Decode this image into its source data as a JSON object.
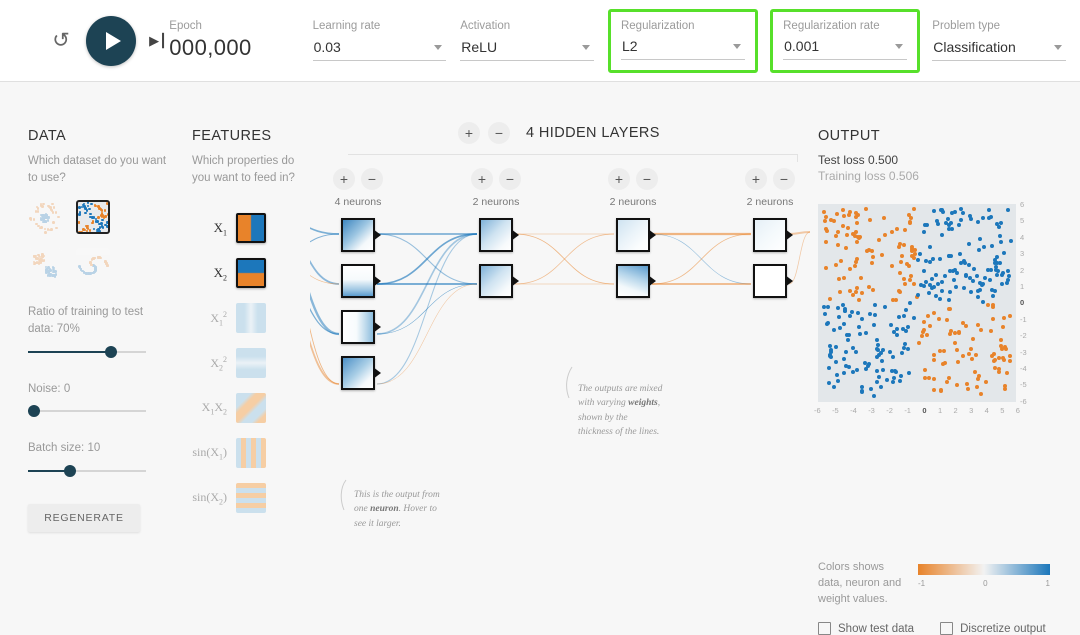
{
  "toolbar": {
    "reset_icon": "reset-icon",
    "play_icon": "play-icon",
    "step_icon": "step-forward-icon",
    "epoch": {
      "label": "Epoch",
      "value": "000,000"
    },
    "controls": [
      {
        "label": "Learning rate",
        "value": "0.03",
        "highlighted": false
      },
      {
        "label": "Activation",
        "value": "ReLU",
        "highlighted": false
      },
      {
        "label": "Regularization",
        "value": "L2",
        "highlighted": true
      },
      {
        "label": "Regularization rate",
        "value": "0.001",
        "highlighted": true
      },
      {
        "label": "Problem type",
        "value": "Classification",
        "highlighted": false
      }
    ]
  },
  "data_panel": {
    "title": "DATA",
    "subtitle": "Which dataset do you want to use?",
    "datasets": [
      {
        "name": "circle",
        "selected": false
      },
      {
        "name": "exclusive-or",
        "selected": true
      },
      {
        "name": "gaussian",
        "selected": false
      },
      {
        "name": "spiral",
        "selected": false
      }
    ],
    "ratio": {
      "label": "Ratio of training to test data:",
      "value": "70%",
      "percent": 70
    },
    "noise": {
      "label": "Noise:",
      "value": "0",
      "percent": 0
    },
    "batch": {
      "label": "Batch size:",
      "value": "10",
      "percent": 36
    },
    "regenerate_label": "REGENERATE"
  },
  "features_panel": {
    "title": "FEATURES",
    "subtitle": "Which properties do you want to feed in?",
    "features": [
      {
        "name": "X1",
        "active": true
      },
      {
        "name": "X2",
        "active": true
      },
      {
        "name": "X1sq",
        "active": false
      },
      {
        "name": "X2sq",
        "active": false
      },
      {
        "name": "X1X2",
        "active": false
      },
      {
        "name": "sinX1",
        "active": false
      },
      {
        "name": "sinX2",
        "active": false
      }
    ]
  },
  "network": {
    "add_label": "+",
    "remove_label": "−",
    "hidden_layers_count": "4",
    "hidden_layers_label": "HIDDEN LAYERS",
    "layers": [
      {
        "neurons_label": "4 neurons",
        "count": 4
      },
      {
        "neurons_label": "2 neurons",
        "count": 2
      },
      {
        "neurons_label": "2 neurons",
        "count": 2
      },
      {
        "neurons_label": "2 neurons",
        "count": 2
      }
    ],
    "annotation_neuron": "This is the output from one neuron. Hover to see it larger.",
    "annotation_weights": "The outputs are mixed with varying weights, shown by the thickness of the lines."
  },
  "output_panel": {
    "title": "OUTPUT",
    "test_loss": "Test loss 0.500",
    "training_loss": "Training loss 0.506",
    "axis_x": [
      "-6",
      "-5",
      "-4",
      "-3",
      "-2",
      "-1",
      "0",
      "1",
      "2",
      "3",
      "4",
      "5",
      "6"
    ],
    "axis_y": [
      "6",
      "5",
      "4",
      "3",
      "2",
      "1",
      "0",
      "-1",
      "-2",
      "-3",
      "-4",
      "-5",
      "-6"
    ],
    "colorbar": {
      "text": "Colors shows data, neuron and weight values.",
      "min": "-1",
      "mid": "0",
      "max": "1",
      "negative_color": "#e8832a",
      "neutral_color": "#f2f2f2",
      "positive_color": "#1c77bb"
    },
    "checkboxes": [
      {
        "label": "Show test data",
        "checked": false
      },
      {
        "label": "Discretize output",
        "checked": false
      }
    ]
  },
  "chart_data": {
    "type": "scatter",
    "title": "OUTPUT",
    "xlabel": "",
    "ylabel": "",
    "xlim": [
      -6,
      6
    ],
    "ylim": [
      -6,
      6
    ],
    "grid": false,
    "legend": "none",
    "classes": [
      {
        "name": "positive",
        "color": "#1c77bb",
        "quadrants": [
          "top-right",
          "bottom-left"
        ]
      },
      {
        "name": "negative",
        "color": "#e8832a",
        "quadrants": [
          "top-left",
          "bottom-right"
        ]
      }
    ],
    "pattern": "xor-checkerboard",
    "n_points": 400
  },
  "colors": {
    "accent_dark": "#1d4354",
    "highlight_green": "#57e02a",
    "orange": "#e8832a",
    "blue": "#1c77bb",
    "background": "#f7f7f7"
  }
}
